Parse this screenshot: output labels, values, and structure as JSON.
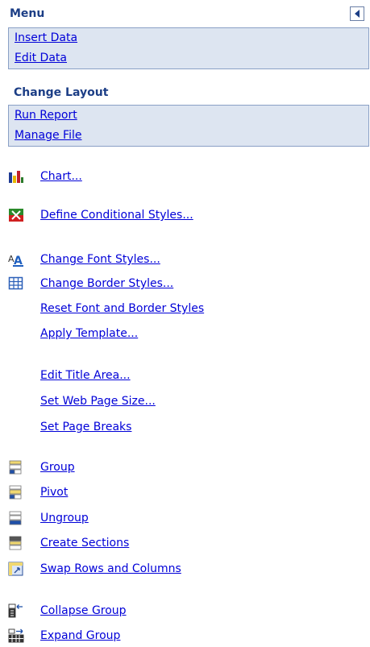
{
  "menu": {
    "title": "Menu",
    "group1": [
      "Insert Data",
      "Edit Data"
    ],
    "section_title": "Change Layout",
    "group2": [
      "Run Report",
      "Manage File"
    ]
  },
  "commands": [
    {
      "label": "Chart...",
      "icon": "chart-icon"
    },
    {
      "label": "Define Conditional Styles...",
      "icon": "conditional-styles-icon"
    },
    {
      "label": "Change Font Styles...",
      "icon": "font-styles-icon"
    },
    {
      "label": "Change Border Styles...",
      "icon": "border-styles-icon"
    },
    {
      "label": "Reset Font and Border Styles",
      "icon": ""
    },
    {
      "label": "Apply Template...",
      "icon": ""
    },
    {
      "label": "Edit Title Area...",
      "icon": ""
    },
    {
      "label": "Set Web Page Size...",
      "icon": ""
    },
    {
      "label": "Set Page Breaks",
      "icon": ""
    },
    {
      "label": "Group",
      "icon": "group-icon"
    },
    {
      "label": "Pivot",
      "icon": "pivot-icon"
    },
    {
      "label": "Ungroup",
      "icon": "ungroup-icon"
    },
    {
      "label": "Create Sections",
      "icon": "create-sections-icon"
    },
    {
      "label": "Swap Rows and Columns",
      "icon": "swap-rows-columns-icon"
    },
    {
      "label": "Collapse Group",
      "icon": "collapse-group-icon"
    },
    {
      "label": "Expand Group",
      "icon": "expand-group-icon"
    }
  ]
}
